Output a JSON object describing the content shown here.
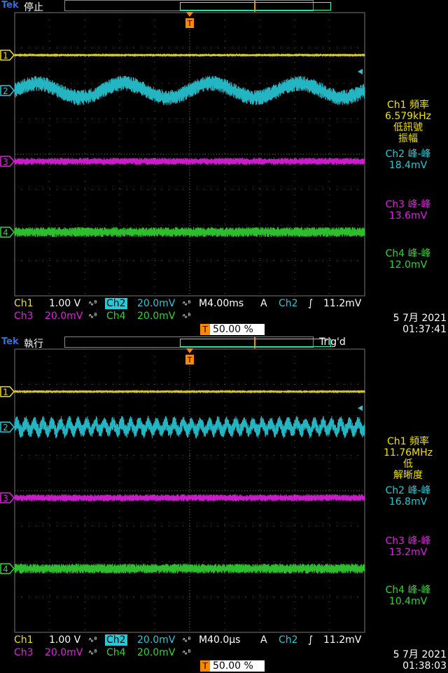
{
  "panels": [
    {
      "brand": "Tek",
      "state": "停止",
      "trig_status": "",
      "channel_labels": [
        "1",
        "2",
        "3",
        "4"
      ],
      "waveforms": {
        "ch1": {
          "color": "#f2e200",
          "level_div": 2.8,
          "noise_div": 0.04,
          "ripple_cycles": 0,
          "ripple_amp_div": 0
        },
        "ch2": {
          "color": "#27c9d7",
          "level_div": 1.8,
          "noise_div": 0.22,
          "ripple_cycles": 4,
          "ripple_amp_div": 0.2
        },
        "ch3": {
          "color": "#e020e0",
          "level_div": -0.2,
          "noise_div": 0.1,
          "ripple_cycles": 0,
          "ripple_amp_div": 0
        },
        "ch4": {
          "color": "#32d232",
          "level_div": -2.2,
          "noise_div": 0.14,
          "ripple_cycles": 0,
          "ripple_amp_div": 0
        }
      },
      "measurements": {
        "m1_title": "Ch1 頻率",
        "m1_value": "6.579kHz",
        "m1_note1": "低訊號",
        "m1_note2": "振幅",
        "m2_title": "Ch2 峰-峰",
        "m2_value": "18.4mV",
        "m3_title": "Ch3 峰-峰",
        "m3_value": "13.6mV",
        "m4_title": "Ch4 峰-峰",
        "m4_value": "12.0mV"
      },
      "settings": {
        "ch1": "Ch1",
        "ch1_scale": "1.00 V",
        "ch2": "Ch2",
        "ch2_scale": "20.0mV",
        "ch3": "Ch3",
        "ch3_scale": "20.0mV",
        "ch4": "Ch4",
        "ch4_scale": "20.0mV",
        "timebase": "M4.00ms",
        "trig_mode": "A",
        "trig_source": "Ch2",
        "trig_slope": "∫",
        "trig_level": "11.2mV",
        "trig_position": "50.00 %"
      },
      "date": "5 7月  2021",
      "time": "01:37:41"
    },
    {
      "brand": "Tek",
      "state": "執行",
      "trig_status": "Trig'd",
      "channel_labels": [
        "1",
        "2",
        "3",
        "4"
      ],
      "waveforms": {
        "ch1": {
          "color": "#f2e200",
          "level_div": 2.8,
          "noise_div": 0.04,
          "ripple_cycles": 0,
          "ripple_amp_div": 0
        },
        "ch2": {
          "color": "#27c9d7",
          "level_div": 1.8,
          "noise_div": 0.2,
          "ripple_cycles": 40,
          "ripple_amp_div": 0.12
        },
        "ch3": {
          "color": "#e020e0",
          "level_div": -0.2,
          "noise_div": 0.1,
          "ripple_cycles": 0,
          "ripple_amp_div": 0
        },
        "ch4": {
          "color": "#32d232",
          "level_div": -2.2,
          "noise_div": 0.14,
          "ripple_cycles": 0,
          "ripple_amp_div": 0
        }
      },
      "measurements": {
        "m1_title": "Ch1 頻率",
        "m1_value": "11.76MHz",
        "m1_note1": "低",
        "m1_note2": "解晰度",
        "m2_title": "Ch2 峰-峰",
        "m2_value": "16.8mV",
        "m3_title": "Ch3 峰-峰",
        "m3_value": "13.2mV",
        "m4_title": "Ch4 峰-峰",
        "m4_value": "10.4mV"
      },
      "settings": {
        "ch1": "Ch1",
        "ch1_scale": "1.00 V",
        "ch2": "Ch2",
        "ch2_scale": "20.0mV",
        "ch3": "Ch3",
        "ch3_scale": "20.0mV",
        "ch4": "Ch4",
        "ch4_scale": "20.0mV",
        "timebase": "M40.0μs",
        "trig_mode": "A",
        "trig_source": "Ch2",
        "trig_slope": "∫",
        "trig_level": "11.2mV",
        "trig_position": "50.00 %"
      },
      "date": "5 7月  2021",
      "time": "01:38:03"
    }
  ],
  "icons": {
    "trigger_marker": "trigger-position-icon",
    "coupling": "bandwidth-limit-icon"
  }
}
